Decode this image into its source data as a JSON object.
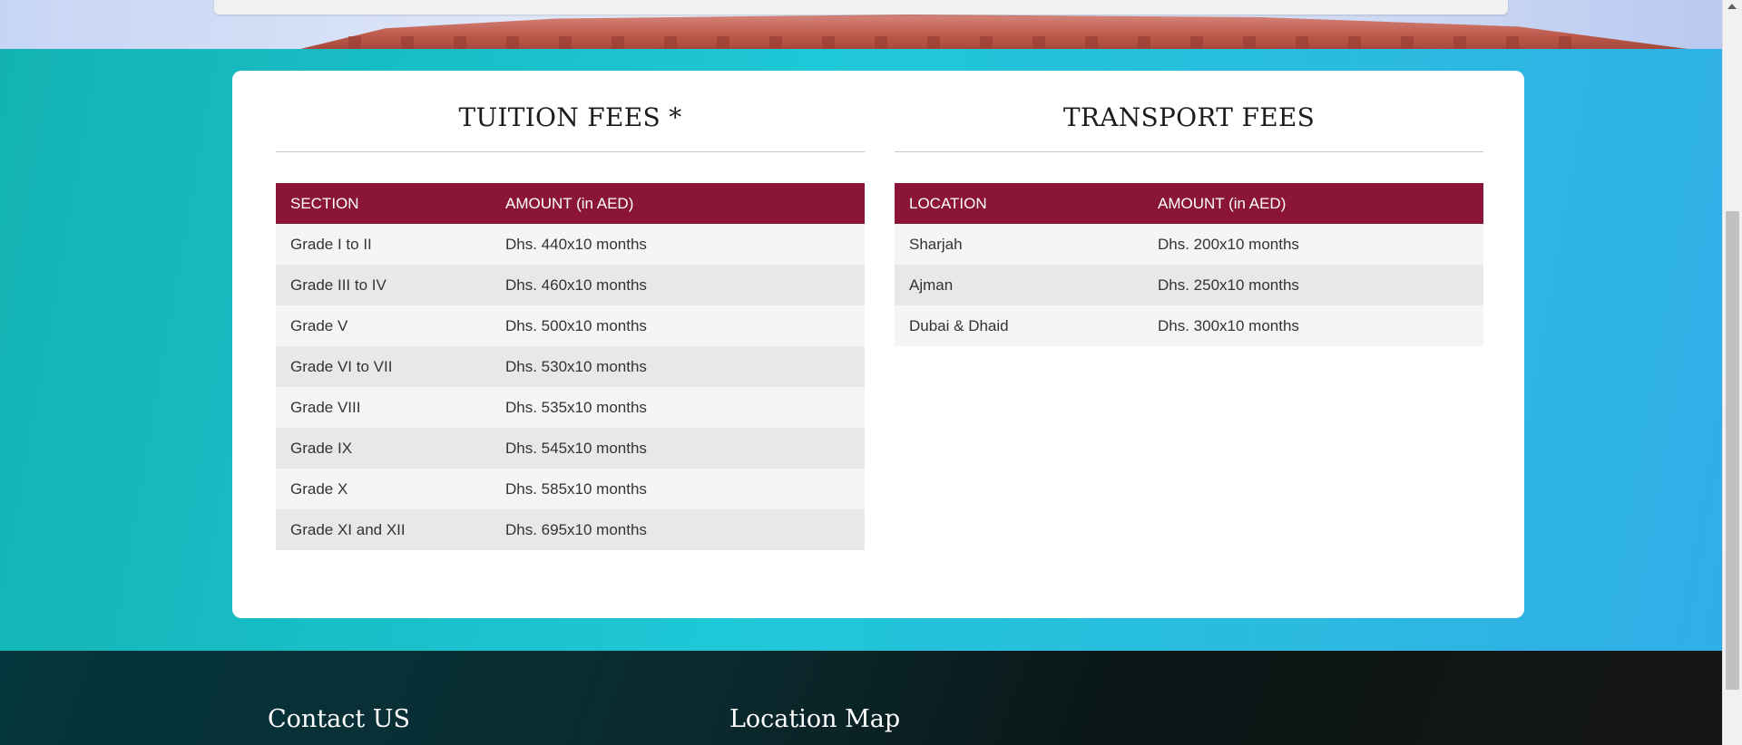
{
  "tuition": {
    "title": "TUITION FEES *",
    "headers": [
      "SECTION",
      "AMOUNT (in AED)"
    ],
    "rows": [
      [
        "Grade I to II",
        "Dhs. 440x10 months"
      ],
      [
        "Grade III to IV",
        "Dhs. 460x10 months"
      ],
      [
        "Grade V",
        "Dhs. 500x10 months"
      ],
      [
        "Grade VI to VII",
        "Dhs. 530x10 months"
      ],
      [
        "Grade VIII",
        "Dhs. 535x10 months"
      ],
      [
        "Grade IX",
        "Dhs. 545x10 months"
      ],
      [
        "Grade X",
        "Dhs. 585x10 months"
      ],
      [
        "Grade XI and XII",
        "Dhs. 695x10 months"
      ]
    ]
  },
  "transport": {
    "title": "TRANSPORT FEES",
    "headers": [
      "LOCATION",
      "AMOUNT (in AED)"
    ],
    "rows": [
      [
        "Sharjah",
        "Dhs. 200x10 months"
      ],
      [
        "Ajman",
        "Dhs. 250x10 months"
      ],
      [
        "Dubai & Dhaid",
        "Dhs. 300x10 months"
      ]
    ]
  },
  "footer": {
    "contact_title": "Contact US",
    "map_title": "Location Map"
  },
  "colors": {
    "table_header": "#8b1538",
    "section_bg": "#1fc8d8",
    "row_light": "#f5f5f5",
    "row_dark": "#e8e8e8"
  }
}
